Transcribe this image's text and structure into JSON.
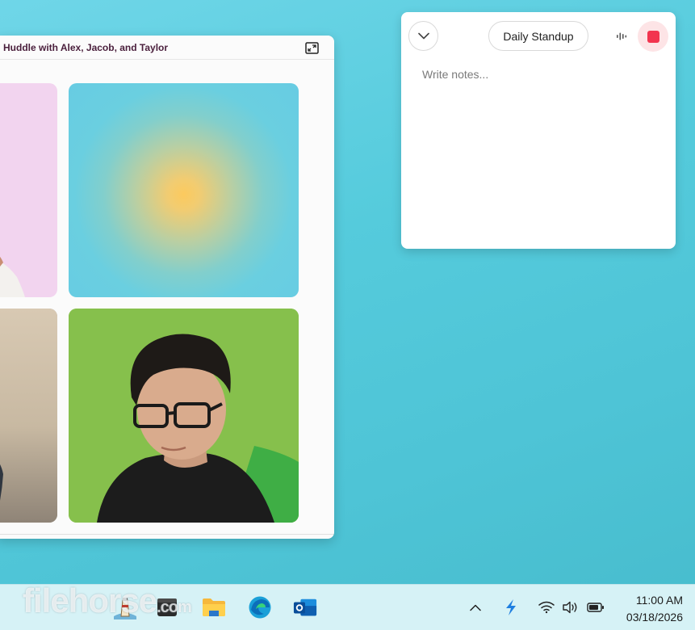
{
  "huddle": {
    "title": "Huddle with Alex, Jacob, and Taylor",
    "participants": [
      "pink-avatar",
      "gradient-avatar",
      "street-photo",
      "green-photo"
    ]
  },
  "notes": {
    "meeting_name": "Daily Standup",
    "placeholder": "Write notes..."
  },
  "taskbar": {
    "watermark": "filehorse",
    "watermark_suffix": ".com",
    "apps": [
      "lighthouse-icon",
      "terminal-icon",
      "file-explorer-icon",
      "edge-icon",
      "outlook-icon"
    ],
    "tray": [
      "chevron-up-icon",
      "copilot-icon",
      "wifi-icon",
      "volume-icon",
      "battery-icon"
    ],
    "time": "11:00 AM",
    "date": "03/18/2026"
  },
  "colors": {
    "record_red": "#f2344f",
    "title_text": "#4a1f3c",
    "desktop": "#55cbdc"
  }
}
